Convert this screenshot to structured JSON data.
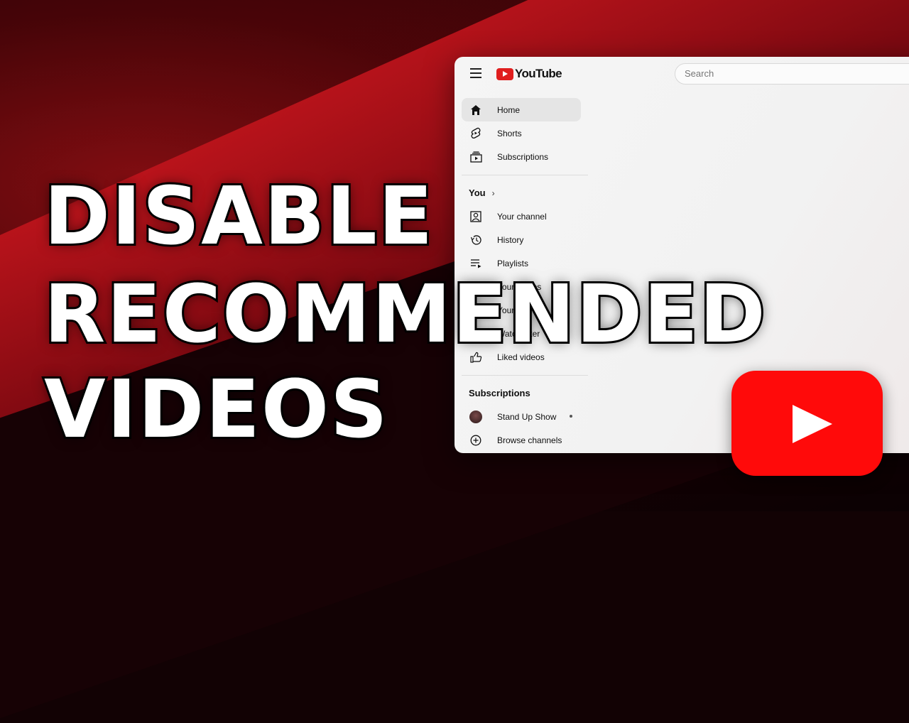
{
  "headline": {
    "line1": "DISABLE",
    "line2": "RECOMMENDED",
    "line3": "VIDEOS"
  },
  "app": {
    "logo_text": "YouTube"
  },
  "search": {
    "placeholder": "Search"
  },
  "sidebar": {
    "main": [
      {
        "label": "Home",
        "icon": "home-icon",
        "active": true
      },
      {
        "label": "Shorts",
        "icon": "shorts-icon"
      },
      {
        "label": "Subscriptions",
        "icon": "subscriptions-icon"
      }
    ],
    "you_title": "You",
    "you_items": [
      {
        "label": "Your channel",
        "icon": "channel-icon"
      },
      {
        "label": "History",
        "icon": "history-icon"
      },
      {
        "label": "Playlists",
        "icon": "playlists-icon"
      },
      {
        "label": "Your videos",
        "icon": "your-videos-icon"
      },
      {
        "label": "Your courses",
        "icon": "courses-icon"
      },
      {
        "label": "Watch later",
        "icon": "clock-icon"
      },
      {
        "label": "Liked videos",
        "icon": "thumbs-up-icon"
      }
    ],
    "subscriptions_title": "Subscriptions",
    "subscriptions": [
      {
        "label": "Stand Up Show",
        "icon": "avatar"
      },
      {
        "label": "Browse channels",
        "icon": "plus-circle-icon"
      }
    ]
  },
  "colors": {
    "brand_red": "#ff0a0a",
    "background_dark": "#120204"
  }
}
